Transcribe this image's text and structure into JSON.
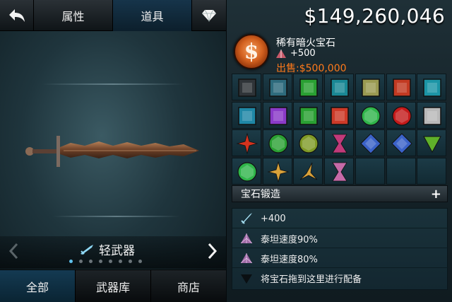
{
  "topbar": {
    "back_icon": "back-arrow-icon",
    "tabs": [
      {
        "label": "属性",
        "active": false
      },
      {
        "label": "道具",
        "active": true
      }
    ],
    "gem_icon": "diamond-icon"
  },
  "category": {
    "label": "轻武器",
    "icon": "sword-icon",
    "page_count": 8,
    "current_page": 1
  },
  "bottom_tabs": [
    {
      "label": "全部",
      "active": true
    },
    {
      "label": "武器库",
      "active": false
    },
    {
      "label": "商店",
      "active": false
    }
  ],
  "currency": {
    "amount": "$149,260,046"
  },
  "selected_gem": {
    "name": "稀有暗火宝石",
    "stat": "+500",
    "price": "出售:$500,000",
    "emblem_glyph": "$",
    "emblem_color": "#d46220",
    "price_color": "#ff7a1a"
  },
  "gem_grid": [
    {
      "shape": "square",
      "color": "#2f3438"
    },
    {
      "shape": "square",
      "color": "#2e6b7d"
    },
    {
      "shape": "square",
      "color": "#2aa033"
    },
    {
      "shape": "square",
      "color": "#1a8895"
    },
    {
      "shape": "square",
      "color": "#9a9a52"
    },
    {
      "shape": "square",
      "color": "#c23a22"
    },
    {
      "shape": "square",
      "color": "#1c95a6"
    },
    {
      "shape": "square",
      "color": "#1f87a6"
    },
    {
      "shape": "square",
      "color": "#8a3ac8"
    },
    {
      "shape": "square",
      "color": "#2aa033"
    },
    {
      "shape": "square",
      "color": "#cc3a28"
    },
    {
      "shape": "circle",
      "color": "#2fb54a"
    },
    {
      "shape": "circle",
      "color": "#c41a1a"
    },
    {
      "shape": "square",
      "color": "#b9b9b9"
    },
    {
      "shape": "star",
      "color": "#d5331e"
    },
    {
      "shape": "circle",
      "color": "#2aa033"
    },
    {
      "shape": "circle",
      "color": "#7f9a26"
    },
    {
      "shape": "hourglass",
      "color": "#c03a7a"
    },
    {
      "shape": "diamond",
      "color": "#3a62c8"
    },
    {
      "shape": "diamond",
      "color": "#3a62c8"
    },
    {
      "shape": "triangle",
      "color": "#5fb02a"
    },
    {
      "shape": "circle",
      "color": "#2fb54a"
    },
    {
      "shape": "star",
      "color": "#d9a23a"
    },
    {
      "shape": "triangle-star",
      "color": "#d9a23a"
    },
    {
      "shape": "hourglass",
      "color": "#c56aa8"
    }
  ],
  "forge": {
    "label": "宝石锻造",
    "plus_label": "+"
  },
  "sockets": [
    {
      "icon": "blade-icon",
      "text": "+400"
    },
    {
      "icon": "gem-triangle-icon",
      "text": "泰坦速度90%"
    },
    {
      "icon": "gem-triangle-icon",
      "text": "泰坦速度80%"
    },
    {
      "icon": "empty-socket-icon",
      "text": "将宝石拖到这里进行配备"
    }
  ]
}
